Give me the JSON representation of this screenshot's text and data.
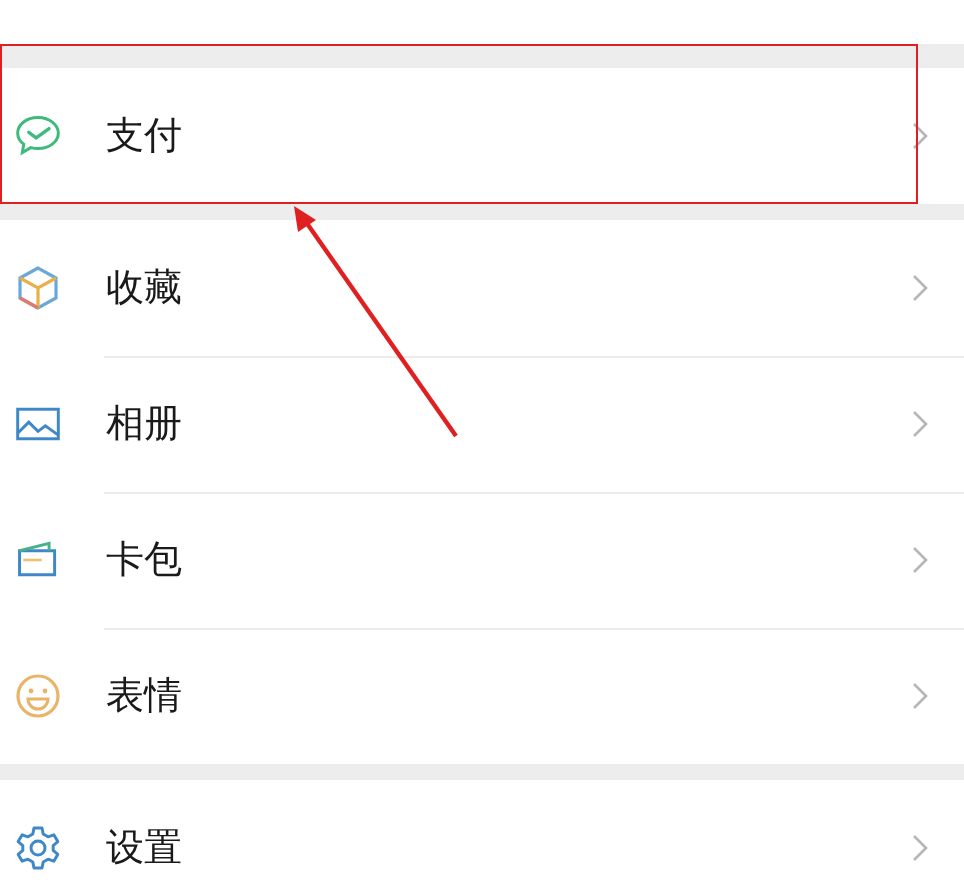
{
  "groups": [
    {
      "items": [
        {
          "kind": "pay",
          "label": "支付",
          "highlighted": true
        }
      ]
    },
    {
      "items": [
        {
          "kind": "favorites",
          "label": "收藏",
          "highlighted": false
        },
        {
          "kind": "album",
          "label": "相册",
          "highlighted": false
        },
        {
          "kind": "cards",
          "label": "卡包",
          "highlighted": false
        },
        {
          "kind": "stickers",
          "label": "表情",
          "highlighted": false
        }
      ]
    },
    {
      "items": [
        {
          "kind": "settings",
          "label": "设置",
          "highlighted": false
        }
      ]
    }
  ]
}
